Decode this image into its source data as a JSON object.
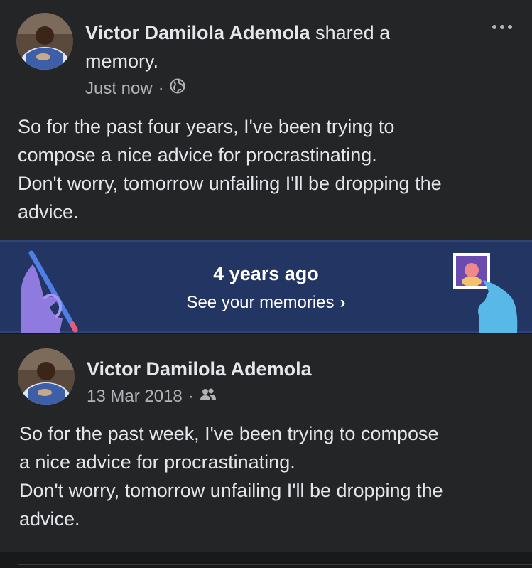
{
  "post": {
    "author": "Victor Damilola Ademola",
    "action": " shared a memory.",
    "time": "Just now",
    "separator": "·",
    "audience_icon": "globe-icon",
    "text_lines": [
      "So for the past four years, I've been trying to",
      "compose a nice advice for procrastinating.",
      "Don't worry, tomorrow unfailing I'll be dropping the",
      "advice."
    ],
    "more_icon": "more-options-icon"
  },
  "memory_banner": {
    "title": "4 years ago",
    "link_label": "See your memories",
    "chevron": "›"
  },
  "shared_post": {
    "author": "Victor Damilola Ademola",
    "date": "13 Mar 2018",
    "separator": "·",
    "audience_icon": "friends-icon",
    "text_lines": [
      "So for the past week, I've been trying to compose",
      "a nice advice for procrastinating.",
      "Don't worry, tomorrow unfailing I'll be dropping the",
      "advice."
    ]
  },
  "colors": {
    "background": "#19191a",
    "card": "#242526",
    "banner": "#233562",
    "primary_text": "#e4e6eb",
    "secondary_text": "#b0b3b8"
  }
}
